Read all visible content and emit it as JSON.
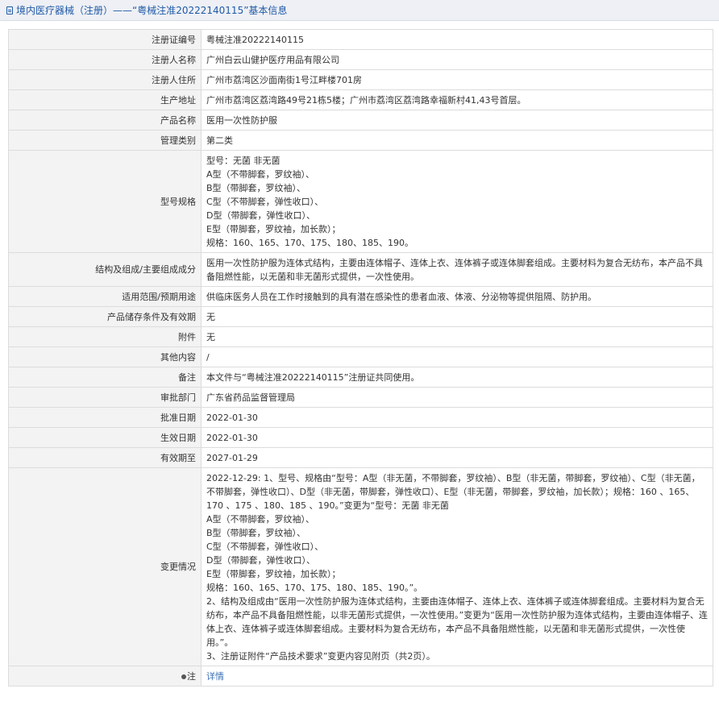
{
  "header": {
    "title": "境内医疗器械（注册）——“粤械注准20222140115”基本信息"
  },
  "rows": {
    "reg_no": {
      "label": "注册证编号",
      "value": "粤械注准20222140115"
    },
    "registrant": {
      "label": "注册人名称",
      "value": "广州白云山健护医疗用品有限公司"
    },
    "residence": {
      "label": "注册人住所",
      "value": "广州市荔湾区沙面南街1号江畔楼701房"
    },
    "production": {
      "label": "生产地址",
      "value": "广州市荔湾区荔湾路49号21栋5楼；广州市荔湾区荔湾路幸福新村41,43号首层。"
    },
    "product_name": {
      "label": "产品名称",
      "value": "医用一次性防护服"
    },
    "category": {
      "label": "管理类别",
      "value": "第二类"
    },
    "model": {
      "label": "型号规格",
      "lines": [
        "型号：无菌 非无菌",
        "A型（不带脚套，罗纹袖）、",
        "B型（带脚套，罗纹袖）、",
        "C型（不带脚套，弹性收口）、",
        "D型（带脚套，弹性收口）、",
        "E型（带脚套，罗纹袖，加长款）；",
        "规格：160、165、170、175、180、185、190。"
      ]
    },
    "structure": {
      "label": "结构及组成/主要组成成分",
      "value": "医用一次性防护服为连体式结构，主要由连体帽子、连体上衣、连体裤子或连体脚套组成。主要材料为复合无纺布，本产品不具备阻燃性能，以无菌和非无菌形式提供，一次性使用。"
    },
    "scope": {
      "label": "适用范围/预期用途",
      "value": "供临床医务人员在工作时接触到的具有潜在感染性的患者血液、体液、分泌物等提供阻隔、防护用。"
    },
    "storage": {
      "label": "产品储存条件及有效期",
      "value": "无"
    },
    "attachment": {
      "label": "附件",
      "value": "无"
    },
    "other": {
      "label": "其他内容",
      "value": "/"
    },
    "remark": {
      "label": "备注",
      "value": "本文件与“粤械注准20222140115”注册证共同使用。"
    },
    "dept": {
      "label": "审批部门",
      "value": "广东省药品监督管理局"
    },
    "approval_date": {
      "label": "批准日期",
      "value": "2022-01-30"
    },
    "effective_date": {
      "label": "生效日期",
      "value": "2022-01-30"
    },
    "expiry": {
      "label": "有效期至",
      "value": "2027-01-29"
    },
    "changes": {
      "label": "变更情况",
      "para1": "2022-12-29: 1、型号、规格由“型号：A型（非无菌，不带脚套，罗纹袖）、B型（非无菌，带脚套，罗纹袖）、C型（非无菌，不带脚套，弹性收口）、D型（非无菌，带脚套，弹性收口）、E型（非无菌，带脚套，罗纹袖，加长款）；规格：160 、165、170 、175 、180、185 、190。”变更为“型号：无菌 非无菌",
      "lines": [
        "A型（不带脚套，罗纹袖）、",
        "B型（带脚套，罗纹袖）、",
        "C型（不带脚套，弹性收口）、",
        "D型（带脚套，弹性收口）、",
        "E型（带脚套，罗纹袖，加长款）；",
        "规格：160、165、170、175、180、185、190。”。"
      ],
      "para2": "2、结构及组成由“医用一次性防护服为连体式结构，主要由连体帽子、连体上衣、连体裤子或连体脚套组成。主要材料为复合无纺布，本产品不具备阻燃性能，以非无菌形式提供，一次性使用。”变更为“医用一次性防护服为连体式结构，主要由连体帽子、连体上衣、连体裤子或连体脚套组成。主要材料为复合无纺布，本产品不具备阻燃性能，以无菌和非无菌形式提供，一次性使用。”。",
      "para3": "3、注册证附件“产品技术要求”变更内容见附页（共2页）。"
    },
    "note": {
      "label": "注",
      "value": "详情"
    }
  }
}
